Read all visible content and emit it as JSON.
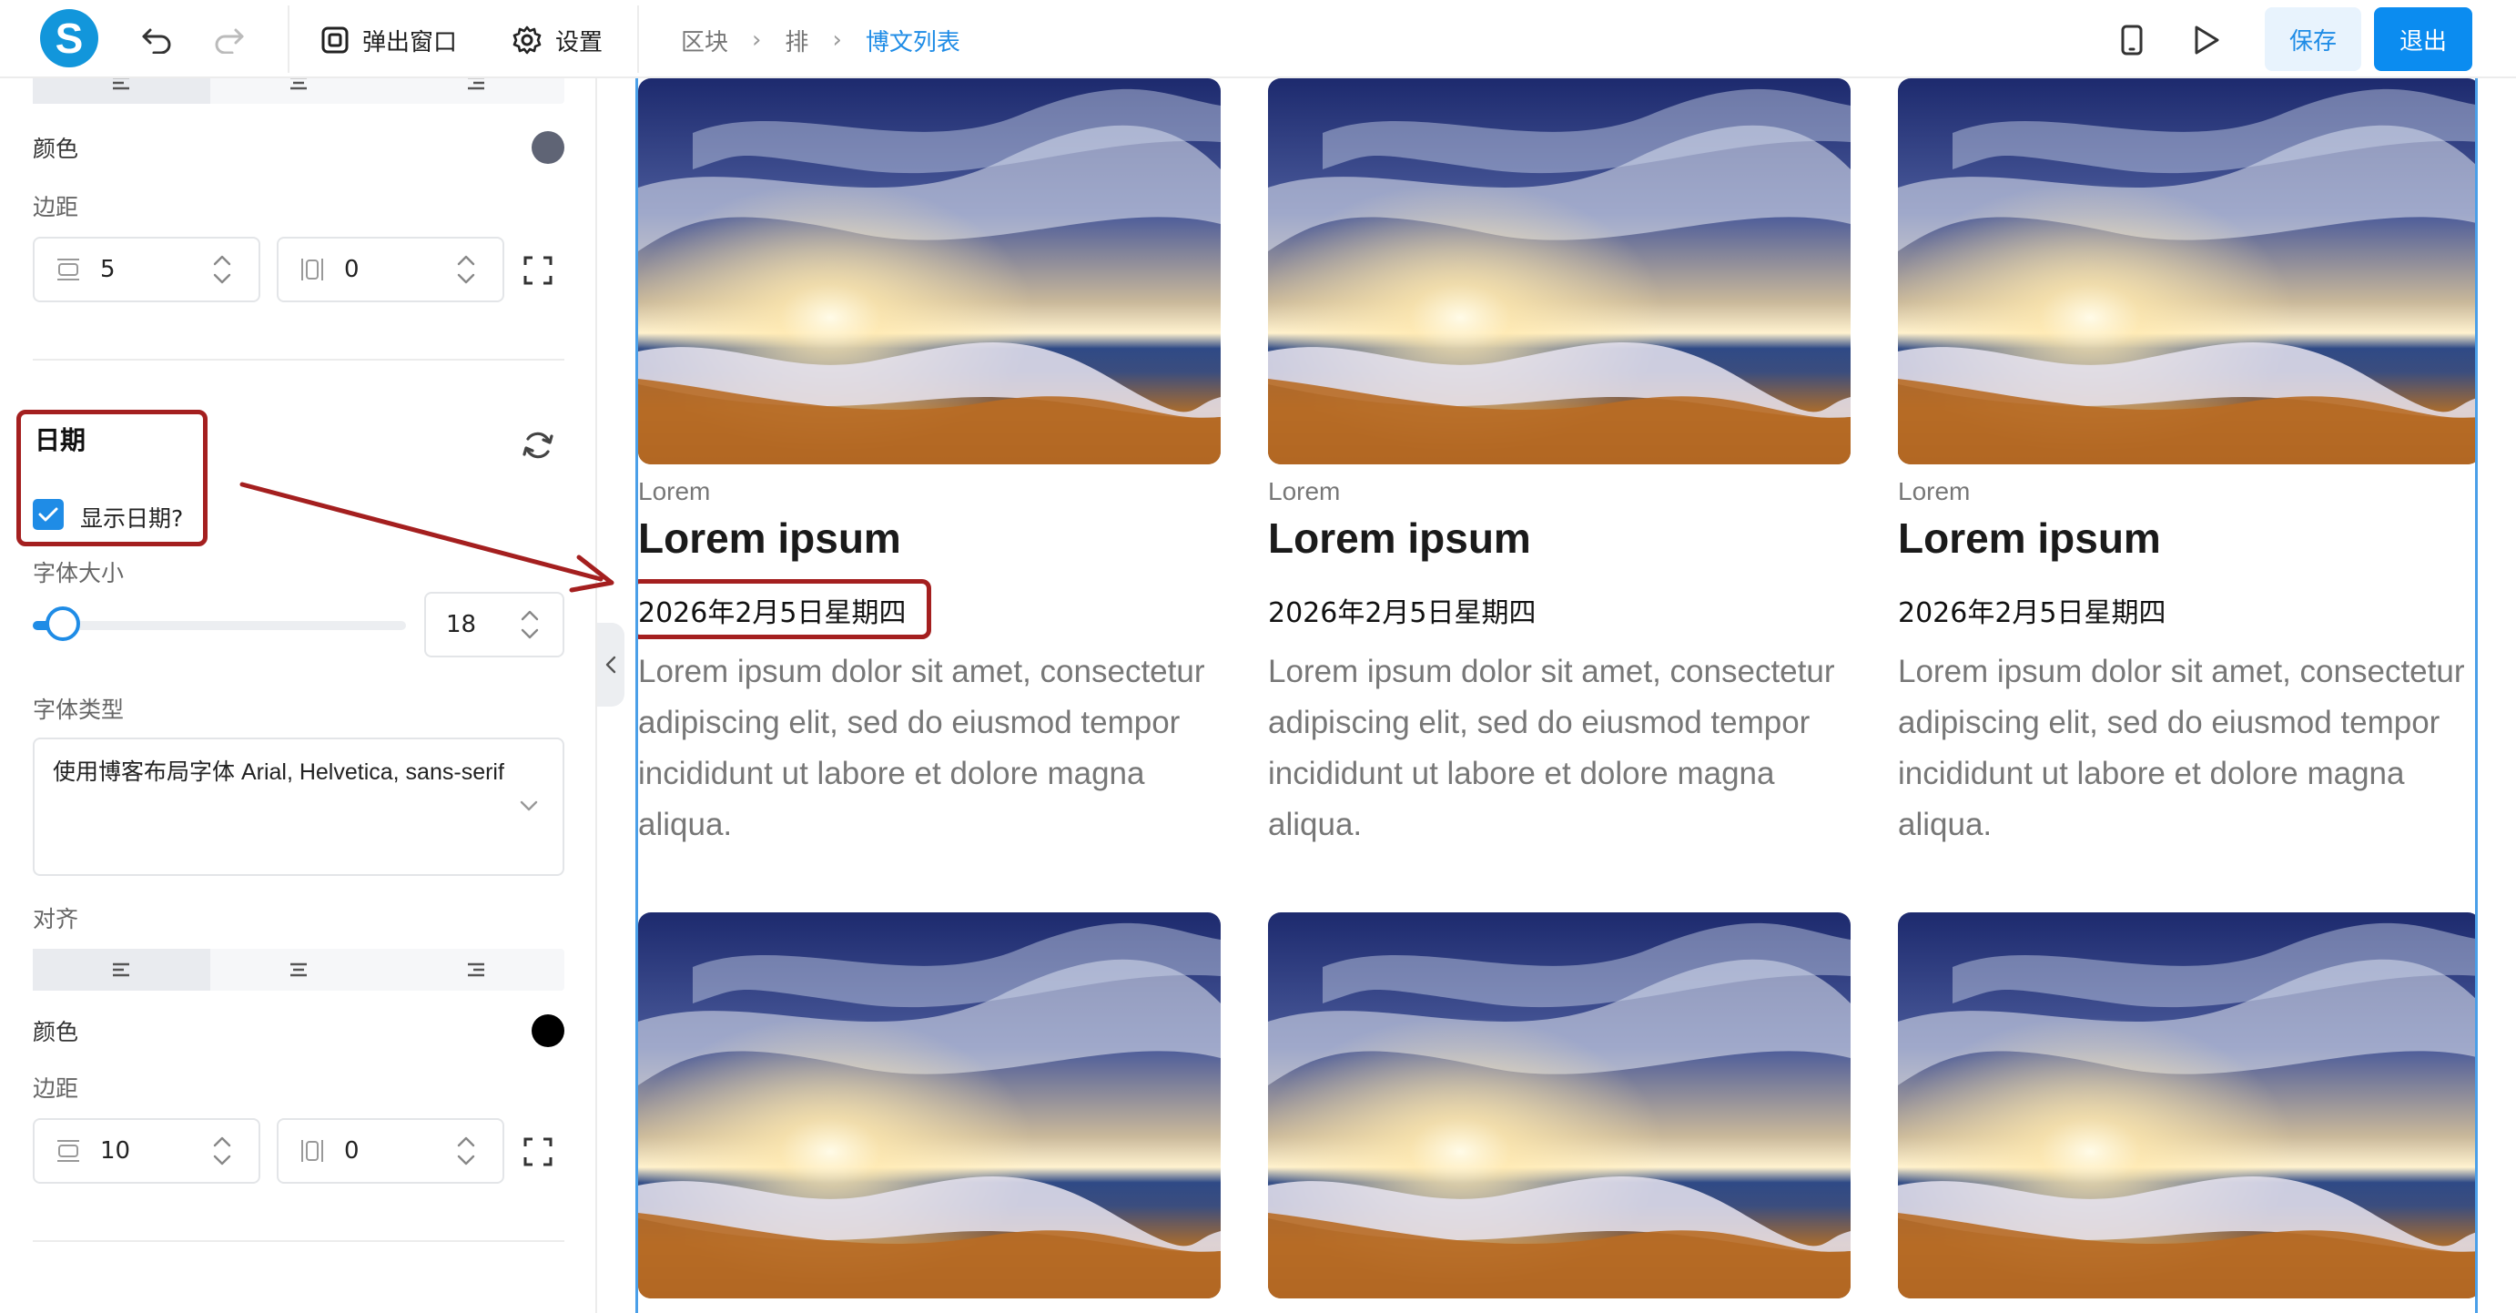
{
  "app": {
    "logo_letter": "S"
  },
  "toolbar": {
    "popup_label": "弹出窗口",
    "settings_label": "设置"
  },
  "breadcrumb": [
    "区块",
    "排",
    "博文列表"
  ],
  "actions": {
    "save_label": "保存",
    "exit_label": "退出"
  },
  "panel": {
    "upper": {
      "color_label": "颜色",
      "color_value": "#5f6475",
      "margin_label": "边距",
      "margin_vertical": "5",
      "margin_horizontal": "0"
    },
    "date_section": {
      "title": "日期",
      "show_date_label": "显示日期?",
      "show_date_checked": true
    },
    "font_size": {
      "label": "字体大小",
      "value": "18",
      "slider_fraction": 0.08
    },
    "font_type": {
      "label": "字体类型",
      "value": "使用博客布局字体 Arial, Helvetica, sans-serif"
    },
    "align": {
      "label": "对齐",
      "selected": "left"
    },
    "lower": {
      "color_label": "颜色",
      "color_value": "#000000",
      "margin_label": "边距",
      "margin_vertical": "10",
      "margin_horizontal": "0"
    }
  },
  "posts": [
    {
      "category": "Lorem",
      "title": "Lorem ipsum",
      "date": "2026年2月5日星期四",
      "excerpt": "Lorem ipsum dolor sit amet, consectetur adipiscing elit, sed do eiusmod tempor incididunt ut labore et dolore magna aliqua."
    },
    {
      "category": "Lorem",
      "title": "Lorem ipsum",
      "date": "2026年2月5日星期四",
      "excerpt": "Lorem ipsum dolor sit amet, consectetur adipiscing elit, sed do eiusmod tempor incididunt ut labore et dolore magna aliqua."
    },
    {
      "category": "Lorem",
      "title": "Lorem ipsum",
      "date": "2026年2月5日星期四",
      "excerpt": "Lorem ipsum dolor sit amet, consectetur adipiscing elit, sed do eiusmod tempor incididunt ut labore et dolore magna aliqua."
    }
  ],
  "icons": {
    "undo": "undo-icon",
    "redo": "redo-icon",
    "popup": "popup-window-icon",
    "settings": "gear-icon",
    "mobile": "mobile-preview-icon",
    "play": "play-icon",
    "refresh": "refresh-icon",
    "collapse": "chevron-left-icon"
  },
  "colors": {
    "accent": "#1f8ce6",
    "annotation": "#a41f1f"
  }
}
